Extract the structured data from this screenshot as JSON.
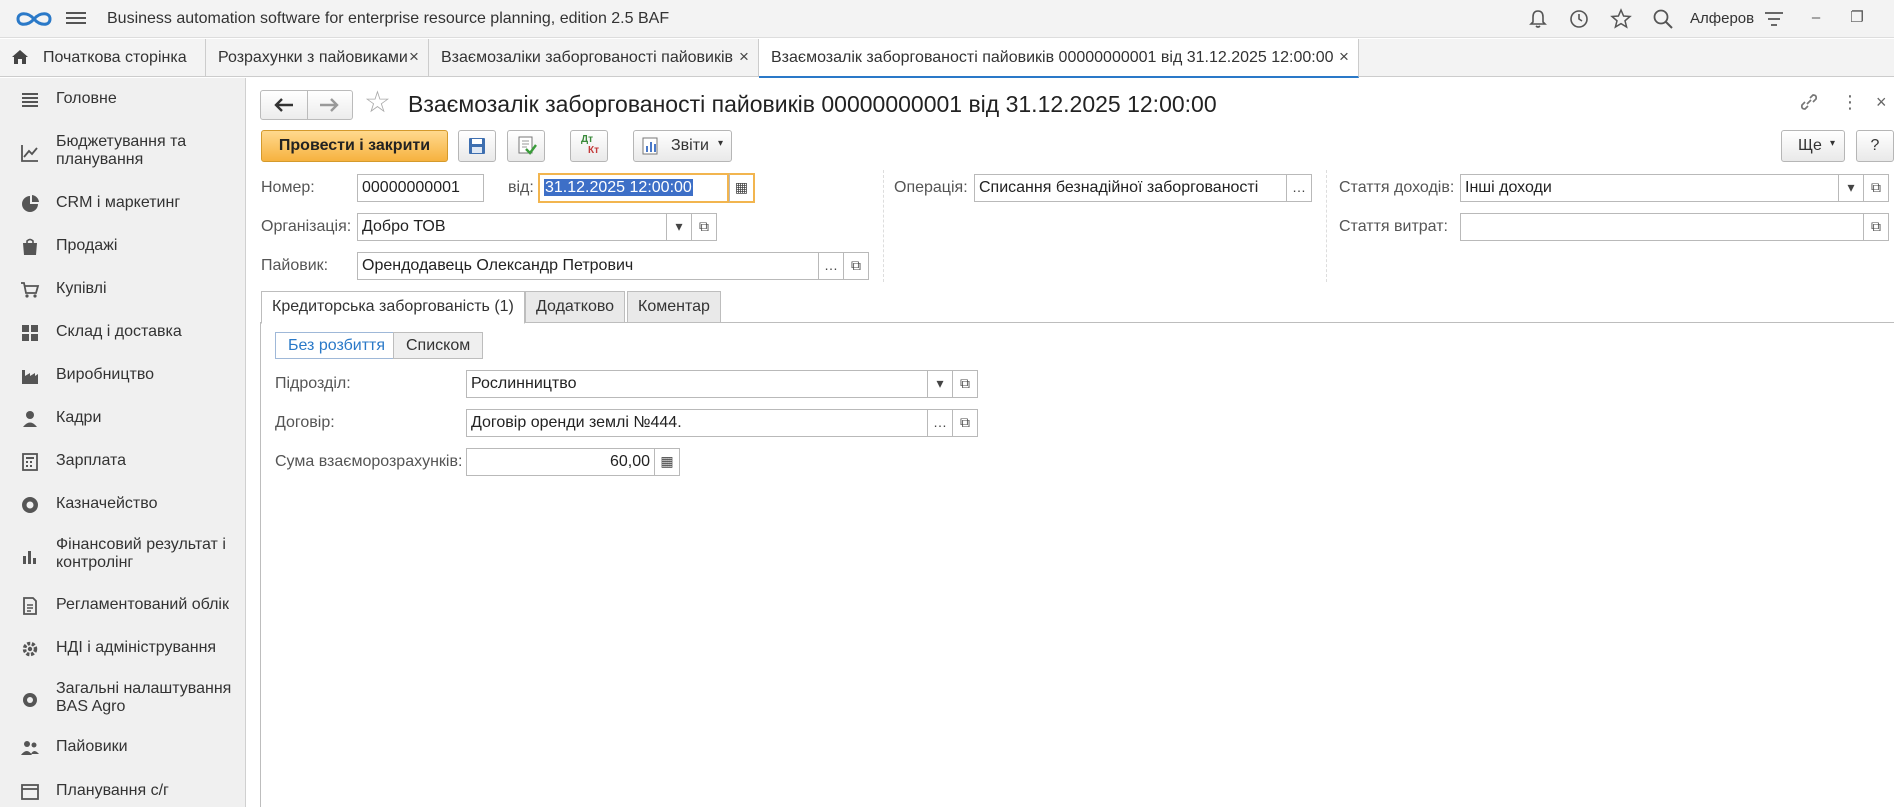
{
  "titlebar": {
    "app_title": "Business automation software for enterprise resource planning, edition 2.5 BAF",
    "user": "Алферов"
  },
  "tabs": [
    {
      "label": "Початкова сторінка"
    },
    {
      "label": "Розрахунки з пайовиками"
    },
    {
      "label": "Взаємозаліки заборгованості пайовиків"
    },
    {
      "label": "Взаємозалік заборгованості пайовиків 00000000001 від 31.12.2025 12:00:00"
    }
  ],
  "sidebar": {
    "items": [
      {
        "label": "Головне"
      },
      {
        "label": "Бюджетування та планування"
      },
      {
        "label": "CRM і маркетинг"
      },
      {
        "label": "Продажі"
      },
      {
        "label": "Купівлі"
      },
      {
        "label": "Склад і доставка"
      },
      {
        "label": "Виробництво"
      },
      {
        "label": "Кадри"
      },
      {
        "label": "Зарплата"
      },
      {
        "label": "Казначейство"
      },
      {
        "label": "Фінансовий результат і контролінг"
      },
      {
        "label": "Регламентований облік"
      },
      {
        "label": "НДІ і адміністрування"
      },
      {
        "label": "Загальні налаштування BAS Agro"
      },
      {
        "label": "Пайовики"
      },
      {
        "label": "Планування с/г"
      }
    ]
  },
  "form": {
    "title": "Взаємозалік заборгованості пайовиків 00000000001 від 31.12.2025 12:00:00",
    "toolbar": {
      "post_close": "Провести і закрити",
      "dt_kt_top": "Дт",
      "dt_kt_bottom": "Кт",
      "reports": "Звіти",
      "more": "Ще",
      "help": "?"
    },
    "number_label": "Номер:",
    "number_value": "00000000001",
    "date_label": "від:",
    "date_value": "31.12.2025 12:00:00",
    "org_label": "Організація:",
    "org_value": "Добро ТОВ",
    "shareholder_label": "Пайовик:",
    "shareholder_value": "Орендодавець Олександр Петрович",
    "operation_label": "Операція:",
    "operation_value": "Списання безнадійної заборгованості",
    "income_label": "Стаття доходів:",
    "income_value": "Інші доходи",
    "expense_label": "Стаття витрат:",
    "expense_value": "",
    "tabs": [
      {
        "label": "Кредиторська заборгованість (1)"
      },
      {
        "label": "Додатково"
      },
      {
        "label": "Коментар"
      }
    ],
    "view_modes": [
      {
        "label": "Без розбиття"
      },
      {
        "label": "Списком"
      }
    ],
    "division_label": "Підрозділ:",
    "division_value": "Рослинництво",
    "contract_label": "Договір:",
    "contract_value": "Договір оренди землі №444.",
    "sum_label": "Сума взаєморозрахунків:",
    "sum_value": "60,00"
  },
  "colors": {
    "accent": "#2a79c8",
    "primary_button": "#f6b23f",
    "selection": "#3d6fc7",
    "focus_border": "#f2b54f"
  }
}
